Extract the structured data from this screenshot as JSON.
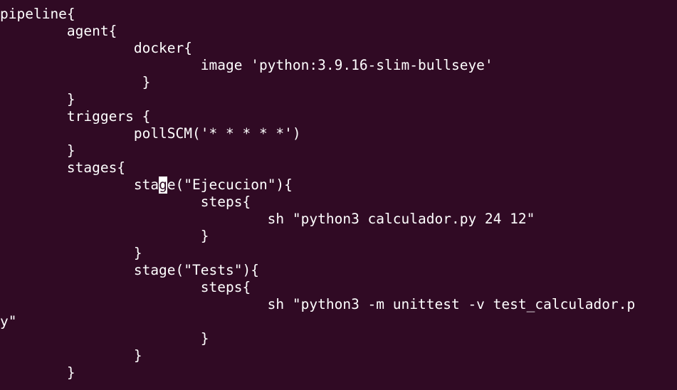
{
  "terminal": {
    "lines": [
      "pipeline{",
      "        agent{",
      "                docker{",
      "                        image 'python:3.9.16-slim-bullseye'",
      "                 }",
      "        }",
      "        triggers {",
      "                pollSCM('* * * * *')",
      "        }",
      "        stages{",
      "                sta",
      "                        steps{",
      "                                sh \"python3 calculador.py 24 12\"",
      "                        }",
      "                }",
      "                stage(\"Tests\"){",
      "                        steps{",
      "                                sh \"python3 -m unittest -v test_calculador.p",
      "y\"",
      "                        }",
      "                }",
      "        }"
    ],
    "cursor_line": {
      "before": "                sta",
      "cursor_char": "g",
      "after": "e(\"Ejecucion\"){"
    },
    "colors": {
      "background": "#300a24",
      "foreground": "#ffffff",
      "cursor": "#ffffff"
    }
  }
}
